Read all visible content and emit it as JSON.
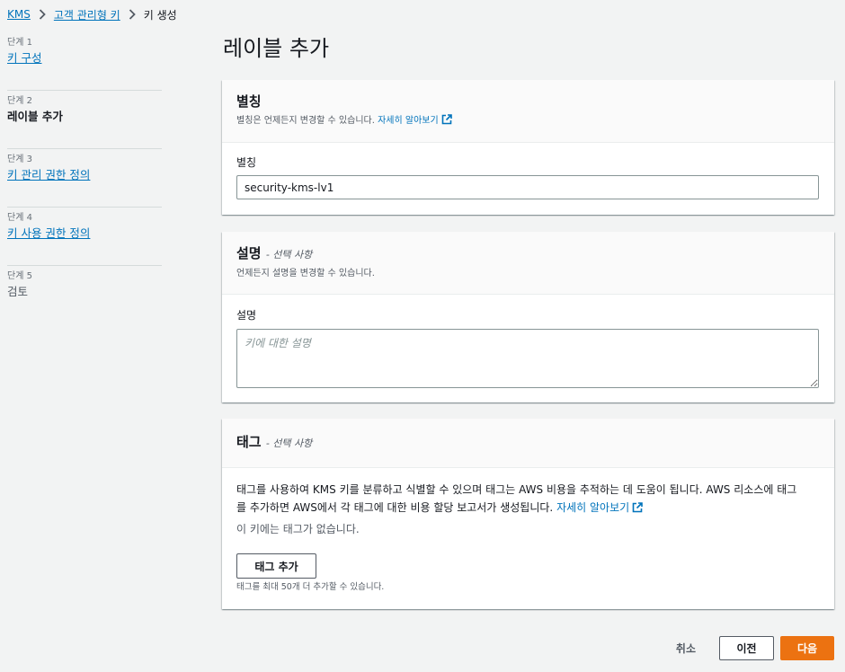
{
  "breadcrumb": {
    "items": [
      "KMS",
      "고객 관리형 키"
    ],
    "current": "키 생성"
  },
  "steps": [
    {
      "number": "단계 1",
      "title": "키 구성",
      "state": "link"
    },
    {
      "number": "단계 2",
      "title": "레이블 추가",
      "state": "active"
    },
    {
      "number": "단계 3",
      "title": "키 관리 권한 정의",
      "state": "link"
    },
    {
      "number": "단계 4",
      "title": "키 사용 권한 정의",
      "state": "link"
    },
    {
      "number": "단계 5",
      "title": "검토",
      "state": "disabled"
    }
  ],
  "page": {
    "title": "레이블 추가"
  },
  "alias_panel": {
    "heading": "별칭",
    "description": "별칭은 언제든지 변경할 수 있습니다.",
    "learn_more": "자세히 알아보기",
    "field_label": "별칭",
    "field_value": "security-kms-lv1"
  },
  "description_panel": {
    "heading": "설명",
    "optional": "- 선택 사항",
    "description": "언제든지 설명을 변경할 수 있습니다.",
    "field_label": "설명",
    "placeholder": "키에 대한 설명"
  },
  "tags_panel": {
    "heading": "태그",
    "optional": "- 선택 사항",
    "body_text_line1": "태그를 사용하여 KMS 키를 분류하고 식별할 수 있으며 태그는 AWS 비용을 추적하는 데 도움이 됩니다. AWS 리소스에 태그",
    "body_text_line2": "를 추가하면 AWS에서 각 태그에 대한 비용 할당 보고서가 생성됩니다.",
    "learn_more": "자세히 알아보기",
    "no_tags": "이 키에는 태그가 없습니다.",
    "add_tag_button": "태그 추가",
    "limit_hint": "태그를 최대 50개 더 추가할 수 있습니다."
  },
  "footer": {
    "cancel": "취소",
    "previous": "이전",
    "next": "다음"
  },
  "colors": {
    "link": "#0073bb",
    "primary": "#ec7211",
    "background": "#f2f3f3"
  },
  "icons": [
    "chevron-right-icon",
    "external-link-icon"
  ]
}
